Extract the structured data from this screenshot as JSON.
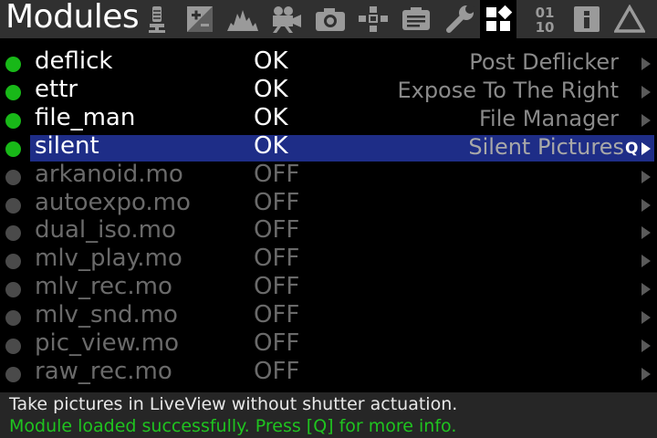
{
  "header": {
    "title": "Modules",
    "tabs": [
      {
        "icon": "microphone-icon"
      },
      {
        "icon": "exposure-plus-minus-icon"
      },
      {
        "icon": "histogram-icon"
      },
      {
        "icon": "movie-camera-icon"
      },
      {
        "icon": "photo-camera-icon"
      },
      {
        "icon": "focus-grid-icon"
      },
      {
        "icon": "display-icon"
      },
      {
        "icon": "wrench-icon"
      },
      {
        "icon": "modules-grid-icon"
      },
      {
        "icon": "debug-binary-icon",
        "label": "01\n10"
      },
      {
        "icon": "info-icon",
        "label": "i"
      },
      {
        "icon": "delta-icon"
      }
    ],
    "active_tab": 8
  },
  "modules": [
    {
      "name": "deflick",
      "status": "OK",
      "description": "Post Deflicker",
      "loaded": true
    },
    {
      "name": "ettr",
      "status": "OK",
      "description": "Expose To The Right",
      "loaded": true
    },
    {
      "name": "file_man",
      "status": "OK",
      "description": "File Manager",
      "loaded": true
    },
    {
      "name": "silent",
      "status": "OK",
      "description": "Silent Pictures",
      "loaded": true,
      "selected": true,
      "qmark": "Q"
    },
    {
      "name": "arkanoid.mo",
      "status": "OFF",
      "description": "",
      "loaded": false
    },
    {
      "name": "autoexpo.mo",
      "status": "OFF",
      "description": "",
      "loaded": false
    },
    {
      "name": "dual_iso.mo",
      "status": "OFF",
      "description": "",
      "loaded": false
    },
    {
      "name": "mlv_play.mo",
      "status": "OFF",
      "description": "",
      "loaded": false
    },
    {
      "name": "mlv_rec.mo",
      "status": "OFF",
      "description": "",
      "loaded": false
    },
    {
      "name": "mlv_snd.mo",
      "status": "OFF",
      "description": "",
      "loaded": false
    },
    {
      "name": "pic_view.mo",
      "status": "OFF",
      "description": "",
      "loaded": false
    },
    {
      "name": "raw_rec.mo",
      "status": "OFF",
      "description": "",
      "loaded": false
    }
  ],
  "footer": {
    "help": "Take pictures in LiveView without shutter actuation.",
    "status_message": "Module loaded successfully. Press [Q] for more info."
  },
  "colors": {
    "selection": "#1e2d87",
    "loaded_dot": "#18b818",
    "unloaded_dot": "#4a4a4a",
    "status_message": "#1fc41f"
  }
}
